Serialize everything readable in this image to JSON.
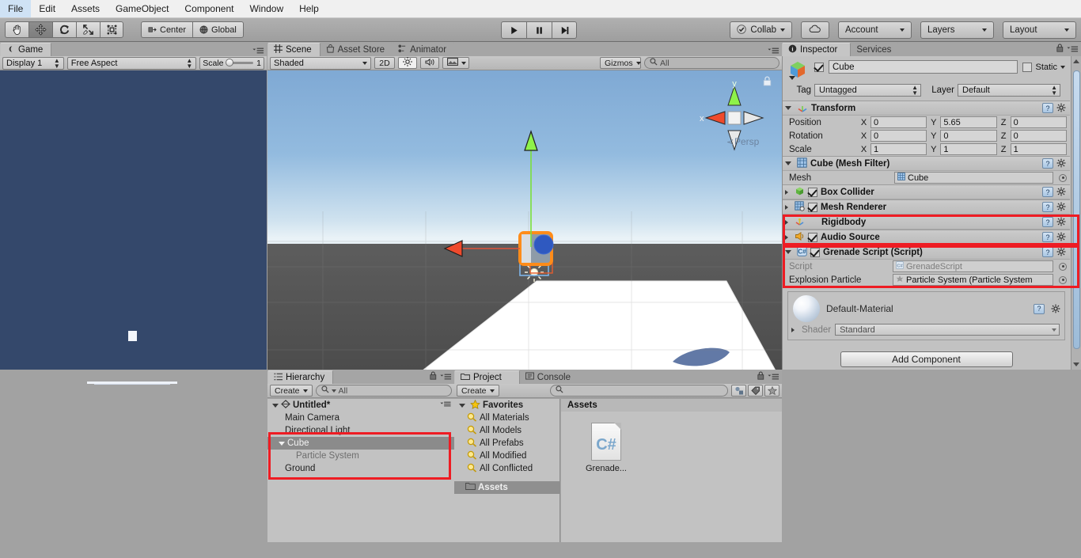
{
  "menubar": {
    "items": [
      "File",
      "Edit",
      "Assets",
      "GameObject",
      "Component",
      "Window",
      "Help"
    ]
  },
  "toolbar": {
    "tools": [
      {
        "name": "hand-tool",
        "icon": "hand-icon"
      },
      {
        "name": "move-tool",
        "icon": "move-icon"
      },
      {
        "name": "rotate-tool",
        "icon": "rotate-icon"
      },
      {
        "name": "scale-tool",
        "icon": "scale-icon"
      },
      {
        "name": "rect-tool",
        "icon": "rect-transform-icon"
      }
    ],
    "pivot_label": "Center",
    "space_label": "Global",
    "play_label": "play-icon",
    "pause_label": "pause-icon",
    "step_label": "step-icon",
    "collab_label": "Collab",
    "cloud_label": "cloud-icon",
    "account_label": "Account",
    "layers_label": "Layers",
    "layout_label": "Layout"
  },
  "game_view": {
    "tab_label": "Game",
    "display_label": "Display 1",
    "aspect_label": "Free Aspect",
    "scale_label": "Scale",
    "scale_value": "1"
  },
  "scene_view": {
    "tabs": [
      "Scene",
      "Asset Store",
      "Animator"
    ],
    "selected_tab": "Scene",
    "shading_label": "Shaded",
    "mode_2d_label": "2D",
    "gizmos_label": "Gizmos",
    "search_placeholder": "All",
    "axis_x_label": "x",
    "axis_y_label": "y",
    "persp_label": "Persp"
  },
  "hierarchy": {
    "tab_label": "Hierarchy",
    "create_label": "Create",
    "search_placeholder": "All",
    "scene_name": "Untitled*",
    "items": [
      {
        "label": "Main Camera",
        "indent": 1,
        "selected": false,
        "dim": false,
        "expandable": false
      },
      {
        "label": "Directional Light",
        "indent": 1,
        "selected": false,
        "dim": false,
        "expandable": false
      },
      {
        "label": "Cube",
        "indent": 1,
        "selected": true,
        "dim": false,
        "expandable": true
      },
      {
        "label": "Particle System",
        "indent": 2,
        "selected": false,
        "dim": true,
        "expandable": false
      },
      {
        "label": "Ground",
        "indent": 1,
        "selected": false,
        "dim": false,
        "expandable": false
      }
    ]
  },
  "project": {
    "tabs": [
      "Project",
      "Console"
    ],
    "selected_tab": "Project",
    "create_label": "Create",
    "favorites_label": "Favorites",
    "favorites": [
      "All Materials",
      "All Models",
      "All Prefabs",
      "All Modified",
      "All Conflicted"
    ],
    "assets_tree_label": "Assets",
    "breadcrumb": "Assets",
    "assets": [
      {
        "label": "Grenade...",
        "icon": "csharp-script-icon"
      }
    ]
  },
  "inspector": {
    "tabs": [
      "Inspector",
      "Services"
    ],
    "selected_tab": "Inspector",
    "object_name": "Cube",
    "object_enabled": true,
    "static_label": "Static",
    "tag_label": "Tag",
    "tag_value": "Untagged",
    "layer_label": "Layer",
    "layer_value": "Default",
    "transform": {
      "title": "Transform",
      "rows": [
        {
          "label": "Position",
          "x": "0",
          "y": "5.65",
          "z": "0"
        },
        {
          "label": "Rotation",
          "x": "0",
          "y": "0",
          "z": "0"
        },
        {
          "label": "Scale",
          "x": "1",
          "y": "1",
          "z": "1"
        }
      ]
    },
    "mesh_filter": {
      "title": "Cube (Mesh Filter)",
      "mesh_label": "Mesh",
      "mesh_value": "Cube"
    },
    "components": [
      {
        "title": "Box Collider",
        "checkbox": true,
        "highlight": false
      },
      {
        "title": "Mesh Renderer",
        "checkbox": true,
        "highlight": false
      },
      {
        "title": "Rigidbody",
        "checkbox": false,
        "highlight": true
      },
      {
        "title": "Audio Source",
        "checkbox": true,
        "highlight": true
      }
    ],
    "script_component": {
      "title": "Grenade Script (Script)",
      "script_label": "Script",
      "script_value": "GrenadeScript",
      "field_label": "Explosion Particle",
      "field_value": "Particle System (Particle System"
    },
    "material": {
      "name": "Default-Material",
      "shader_label": "Shader",
      "shader_value": "Standard"
    },
    "add_component_label": "Add Component"
  },
  "colors": {
    "highlight_red": "#ee1c23",
    "game_background": "#34486b",
    "panel_gray": "#c2c2c2",
    "chrome_gray": "#a2a2a2"
  }
}
